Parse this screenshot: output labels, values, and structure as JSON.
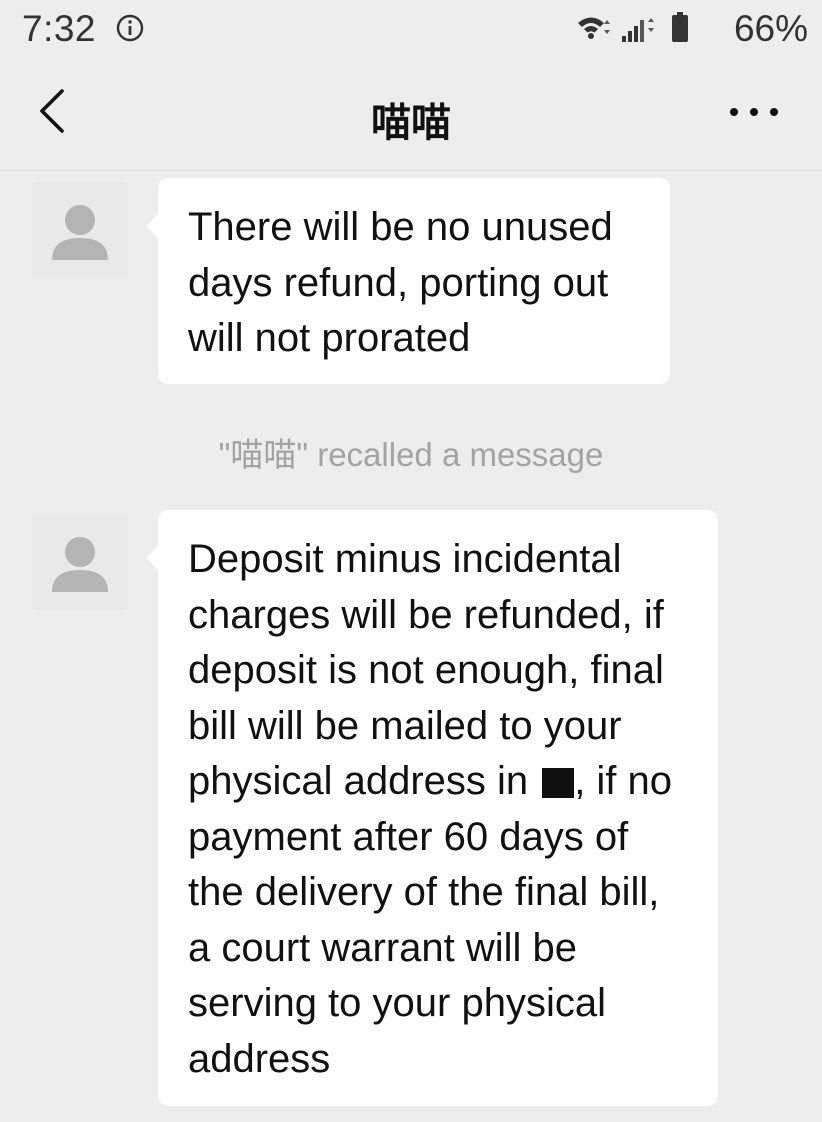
{
  "status_bar": {
    "time": "7:32",
    "battery": "66%",
    "icons": [
      "info-icon",
      "wifi-icon",
      "signal-icon",
      "battery-icon"
    ]
  },
  "header": {
    "title": "喵喵",
    "back_icon": "chevron-left-icon",
    "more_icon": "more-dots-icon"
  },
  "messages": [
    {
      "sender": "喵喵",
      "avatar": "default-avatar-icon",
      "text": "There will be no unused days refund, porting out will not prorated"
    },
    {
      "sender": "喵喵",
      "avatar": "default-avatar-icon",
      "text_before_redaction": "Deposit minus incidental charges will be refunded, if deposit is not enough, final bill will be mailed to your physical address in",
      "text_after_redaction": ", if no payment after 60 days of the delivery of the final bill, a court warrant will be serving to your physical address"
    }
  ],
  "system_notice": "\"喵喵\" recalled a message",
  "colors": {
    "background": "#ededed",
    "bubble": "#ffffff",
    "notice_text": "#a3a3a3",
    "avatar_bg": "#e9e9e9",
    "avatar_fg": "#b4b4b4"
  }
}
